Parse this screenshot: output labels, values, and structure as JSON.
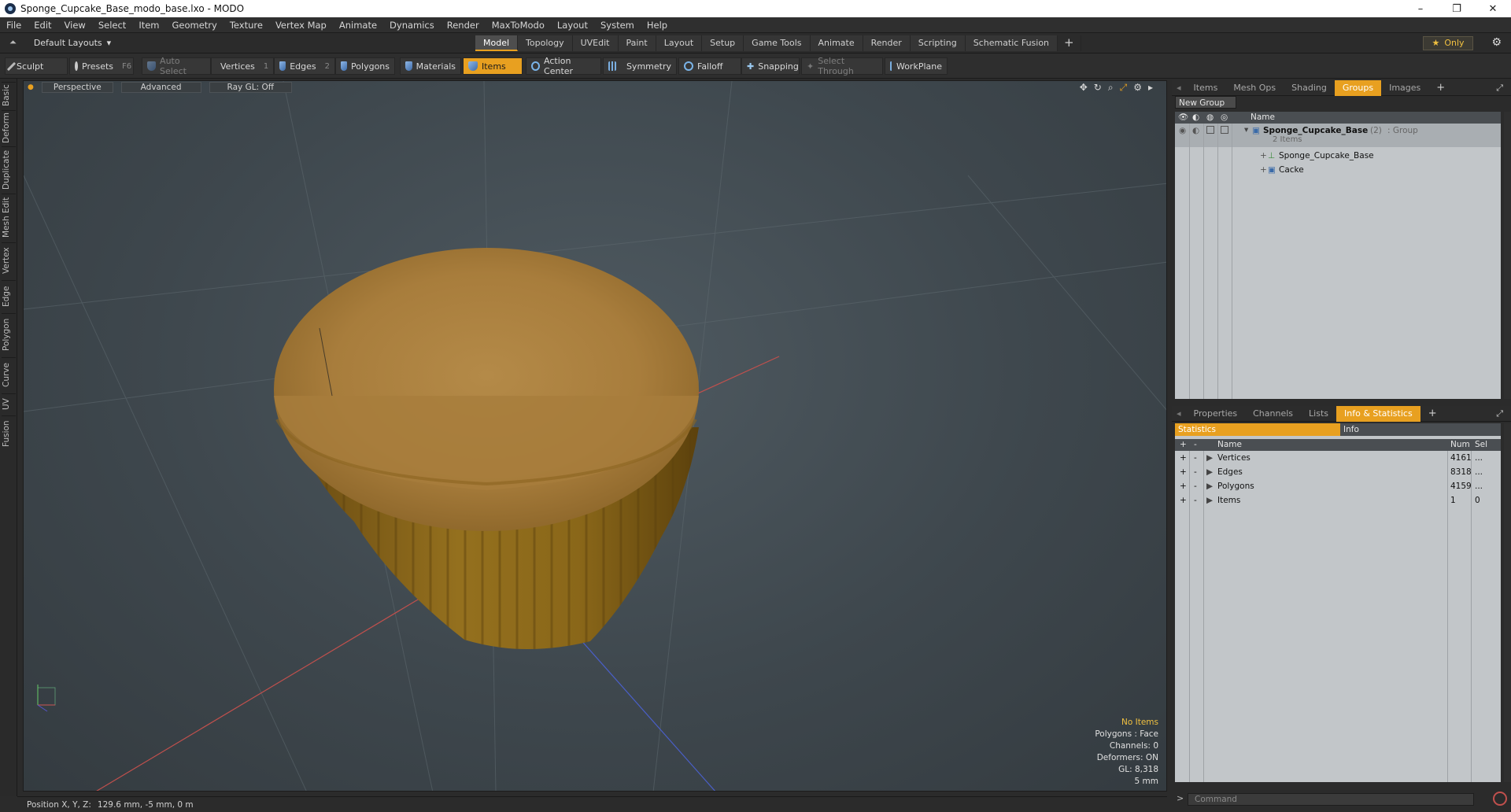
{
  "window": {
    "title": "Sponge_Cupcake_Base_modo_base.lxo - MODO",
    "controls": [
      "–",
      "❐",
      "✕"
    ]
  },
  "menu": [
    "File",
    "Edit",
    "View",
    "Select",
    "Item",
    "Geometry",
    "Texture",
    "Vertex Map",
    "Animate",
    "Dynamics",
    "Render",
    "MaxToModo",
    "Layout",
    "System",
    "Help"
  ],
  "layout": {
    "default_layouts": "Default Layouts",
    "only": "Only",
    "tabs": [
      "Model",
      "Topology",
      "UVEdit",
      "Paint",
      "Layout",
      "Setup",
      "Game Tools",
      "Animate",
      "Render",
      "Scripting",
      "Schematic Fusion"
    ],
    "active_tab": "Model"
  },
  "toolbar": {
    "sculpt": "Sculpt",
    "presets": "Presets",
    "presets_key": "F6",
    "auto_select": "Auto Select",
    "vertices": "Vertices",
    "vertices_key": "1",
    "edges": "Edges",
    "edges_key": "2",
    "polygons": "Polygons",
    "materials": "Materials",
    "items": "Items",
    "action_center": "Action Center",
    "symmetry": "Symmetry",
    "falloff": "Falloff",
    "snapping": "Snapping",
    "select_through": "Select Through",
    "workplane": "WorkPlane"
  },
  "left_tabs": [
    "Basic",
    "Deform",
    "Duplicate",
    "Mesh Edit",
    "Vertex",
    "Edge",
    "Polygon",
    "Curve",
    "UV",
    "Fusion"
  ],
  "viewport": {
    "perspective": "Perspective",
    "advanced": "Advanced",
    "raygl": "Ray GL: Off",
    "info": {
      "no_items": "No Items",
      "polygons": "Polygons : Face",
      "channels": "Channels: 0",
      "deformers": "Deformers: ON",
      "gl": "GL: 8,318",
      "scale": "5 mm"
    }
  },
  "status": {
    "position_label": "Position X, Y, Z:",
    "position_value": "129.6 mm, -5 mm, 0 m"
  },
  "top_panel": {
    "tabs": [
      "Items",
      "Mesh Ops",
      "Shading",
      "Groups",
      "Images"
    ],
    "active": "Groups",
    "new_group": "New Group",
    "name_col": "Name",
    "group": {
      "name": "Sponge_Cupcake_Base",
      "count": "(2)",
      "type": ": Group",
      "sub": "2 Items"
    },
    "children": [
      "Sponge_Cupcake_Base",
      "Cacke"
    ]
  },
  "bottom_panel": {
    "tabs": [
      "Properties",
      "Channels",
      "Lists",
      "Info & Statistics"
    ],
    "active": "Info & Statistics",
    "subtabs": [
      "Statistics",
      "Info"
    ],
    "headers": {
      "name": "Name",
      "num": "Num",
      "sel": "Sel"
    },
    "rows": [
      {
        "name": "Vertices",
        "num": "4161",
        "sel": "..."
      },
      {
        "name": "Edges",
        "num": "8318",
        "sel": "..."
      },
      {
        "name": "Polygons",
        "num": "4159",
        "sel": "..."
      },
      {
        "name": "Items",
        "num": "1",
        "sel": "0"
      }
    ],
    "command_placeholder": "Command"
  },
  "colors": {
    "accent": "#e8a020",
    "x_axis": "#c0504d",
    "z_axis": "#4a5fc8"
  }
}
